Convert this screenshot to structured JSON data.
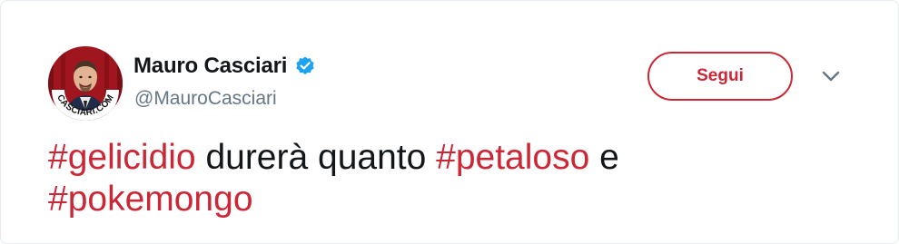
{
  "user": {
    "display_name": "Mauro Casciari",
    "handle": "@MauroCasciari",
    "verified": true,
    "avatar_text": "CASCIARI.COM"
  },
  "actions": {
    "follow_label": "Segui",
    "more_icon": "chevron-down-icon"
  },
  "tweet": {
    "hashtag_1": "#gelicidio",
    "text_1": " durerà quanto ",
    "hashtag_2": "#petaloso",
    "text_2": " e",
    "hashtag_3": "#pokemongo"
  },
  "colors": {
    "accent": "#cc2736",
    "text": "#14171a",
    "muted": "#657786",
    "verified": "#1da1f2"
  }
}
